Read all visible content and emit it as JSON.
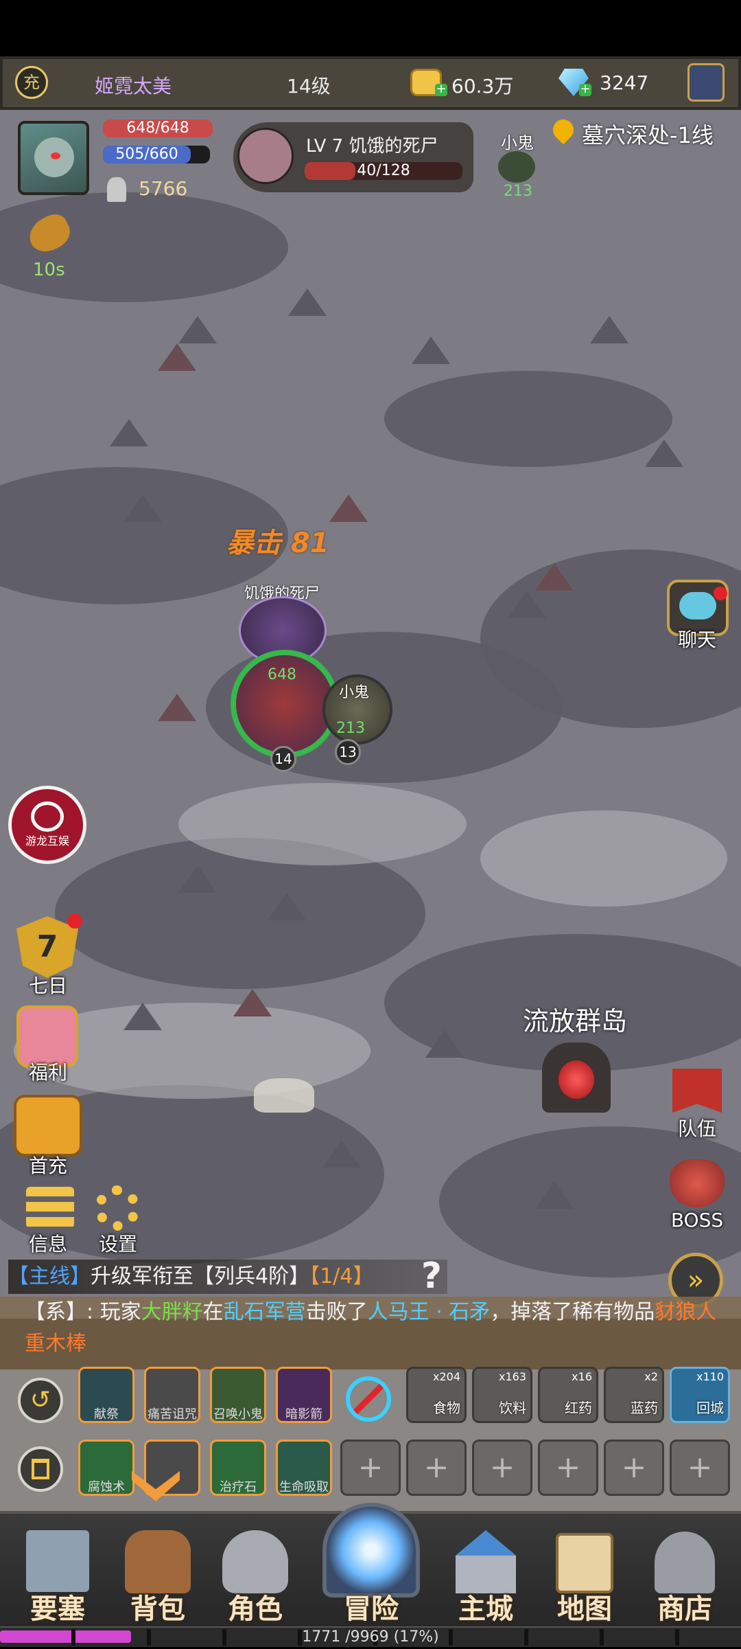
{
  "topbar": {
    "recharge_icon": "充",
    "player_name": "姬霓太美",
    "level": "14级",
    "gold": "60.3万",
    "diamonds": "3247"
  },
  "player": {
    "hp": "648/648",
    "mp": "505/660",
    "power": "5766",
    "food_timer": "10s"
  },
  "target": {
    "title": "LV 7 饥饿的死尸",
    "hp": "40/128"
  },
  "pet": {
    "name": "小鬼",
    "value": "213"
  },
  "location": "墓穴深处-1线",
  "combat": {
    "crit_text": "暴击 81",
    "enemy_name": "饥饿的死尸",
    "hero_hp": "648",
    "hero_level": "14",
    "pet_name": "小鬼",
    "pet_hp": "213",
    "pet_level": "13"
  },
  "side_left": {
    "logo_text": "游龙互娱",
    "seven_day_badge": "7",
    "seven_day": "七日",
    "welfare": "福利",
    "first_charge": "首充",
    "info": "信息",
    "settings": "设置"
  },
  "side_right": {
    "chat": "聊天",
    "team": "队伍",
    "boss": "BOSS"
  },
  "map_label": "流放群岛",
  "quest": {
    "tag": "【主线】",
    "text": "升级军衔至【列兵4阶】",
    "progress": "【1/4】"
  },
  "system_msg": {
    "prefix": "【系】: 玩家",
    "p1": "大胖籽",
    "mid1": "在",
    "p2": "乱石军营",
    "mid2": "击败了",
    "p3": "人马王 · 石矛",
    "mid3": "，掉落了稀有物品",
    "p4": "豺狼人重木棒"
  },
  "skills_row1": [
    "献祭",
    "痛苦诅咒",
    "召唤小鬼",
    "暗影箭"
  ],
  "skills_row2": [
    "腐蚀术",
    "",
    "治疗石",
    "生命吸取"
  ],
  "items": [
    {
      "count": "x204",
      "label": "食物"
    },
    {
      "count": "x163",
      "label": "饮料"
    },
    {
      "count": "x16",
      "label": "红药"
    },
    {
      "count": "x2",
      "label": "蓝药"
    },
    {
      "count": "x110",
      "label": "回城"
    }
  ],
  "nav": [
    "要塞",
    "背包",
    "角色",
    "冒险",
    "主城",
    "地图",
    "商店"
  ],
  "exp": {
    "text": "1771 /9969 (17%)",
    "fraction": 0.177
  },
  "colors": {
    "accent_orange": "#f29c3b",
    "quest_blue": "#4fa3ff",
    "green_name": "#7bde4a",
    "red_item": "#ff7a2a"
  }
}
